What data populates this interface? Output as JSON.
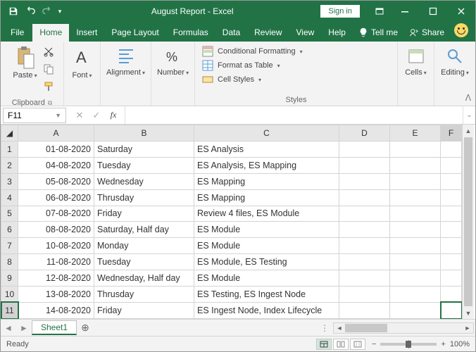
{
  "titlebar": {
    "doc_title": "August Report  -  Excel",
    "signin": "Sign in"
  },
  "tabs": {
    "file": "File",
    "home": "Home",
    "insert": "Insert",
    "pagelayout": "Page Layout",
    "formulas": "Formulas",
    "data": "Data",
    "review": "Review",
    "view": "View",
    "help": "Help",
    "tellme": "Tell me",
    "share": "Share"
  },
  "ribbon": {
    "clipboard": {
      "paste": "Paste",
      "label": "Clipboard"
    },
    "font": {
      "btn": "Font"
    },
    "alignment": {
      "btn": "Alignment"
    },
    "number": {
      "btn": "Number"
    },
    "styles": {
      "cond": "Conditional Formatting",
      "table": "Format as Table",
      "cell": "Cell Styles",
      "label": "Styles"
    },
    "cells": {
      "btn": "Cells"
    },
    "editing": {
      "btn": "Editing"
    }
  },
  "namebox": "F11",
  "columns": [
    "A",
    "B",
    "C",
    "D",
    "E",
    "F"
  ],
  "rows": [
    {
      "n": "1",
      "a": "01-08-2020",
      "b": "Saturday",
      "c": "ES Analysis"
    },
    {
      "n": "2",
      "a": "04-08-2020",
      "b": "Tuesday",
      "c": "ES Analysis, ES Mapping"
    },
    {
      "n": "3",
      "a": "05-08-2020",
      "b": "Wednesday",
      "c": "ES Mapping"
    },
    {
      "n": "4",
      "a": "06-08-2020",
      "b": "Thrusday",
      "c": "ES Mapping"
    },
    {
      "n": "5",
      "a": "07-08-2020",
      "b": "Friday",
      "c": "Review 4 files, ES Module"
    },
    {
      "n": "6",
      "a": "08-08-2020",
      "b": "Saturday, Half day",
      "c": "ES Module"
    },
    {
      "n": "7",
      "a": "10-08-2020",
      "b": "Monday",
      "c": "ES Module"
    },
    {
      "n": "8",
      "a": "11-08-2020",
      "b": "Tuesday",
      "c": "ES Module, ES Testing"
    },
    {
      "n": "9",
      "a": "12-08-2020",
      "b": "Wednesday, Half day",
      "c": "ES Module"
    },
    {
      "n": "10",
      "a": "13-08-2020",
      "b": "Thrusday",
      "c": "ES Testing, ES Ingest Node"
    },
    {
      "n": "11",
      "a": "14-08-2020",
      "b": "Friday",
      "c": "ES Ingest Node, Index Lifecycle"
    }
  ],
  "sheet": {
    "name": "Sheet1"
  },
  "status": {
    "ready": "Ready",
    "zoom": "100%"
  }
}
